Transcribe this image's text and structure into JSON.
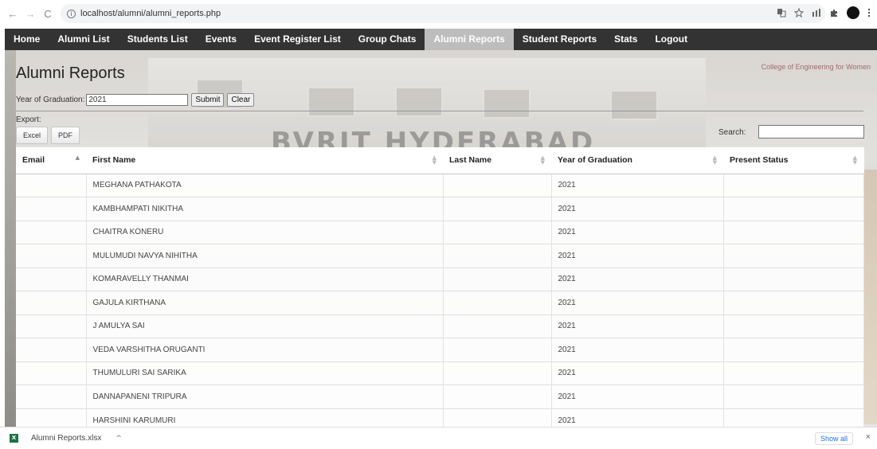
{
  "browser": {
    "url": "localhost/alumni/alumni_reports.php",
    "back_glyph": "←",
    "forward_glyph": "→",
    "reload_glyph": "C",
    "info_glyph": "i",
    "toolbar_icons": [
      "translate-icon",
      "star-icon",
      "media-icon",
      "extensions-icon",
      "profile-icon",
      "menu-icon"
    ]
  },
  "nav": {
    "items": [
      "Home",
      "Alumni List",
      "Students List",
      "Events",
      "Event Register List",
      "Group Chats",
      "Alumni Reports",
      "Student Reports",
      "Stats",
      "Logout"
    ],
    "active": "Alumni Reports"
  },
  "page": {
    "title": "Alumni Reports",
    "watermark": "BVRIT HYDERABAD",
    "sign_text": "College of Engineering for Women"
  },
  "filter": {
    "label": "Year of Graduation:",
    "value": "2021",
    "submit_label": "Submit",
    "clear_label": "Clear"
  },
  "export": {
    "label": "Export:",
    "excel_label": "Excel",
    "pdf_label": "PDF"
  },
  "search": {
    "label": "Search:",
    "value": ""
  },
  "table": {
    "columns": [
      "Email",
      "First Name",
      "Last Name",
      "Year of Graduation",
      "Present Status"
    ],
    "rows": [
      {
        "email": "",
        "first_name": "MEGHANA PATHAKOTA",
        "last_name": "",
        "year": "2021",
        "status": ""
      },
      {
        "email": "",
        "first_name": "KAMBHAMPATI NIKITHA",
        "last_name": "",
        "year": "2021",
        "status": ""
      },
      {
        "email": "",
        "first_name": "CHAITRA KONERU",
        "last_name": "",
        "year": "2021",
        "status": ""
      },
      {
        "email": "",
        "first_name": "MULUMUDI NAVYA NIHITHA",
        "last_name": "",
        "year": "2021",
        "status": ""
      },
      {
        "email": "",
        "first_name": "KOMARAVELLY THANMAI",
        "last_name": "",
        "year": "2021",
        "status": ""
      },
      {
        "email": "",
        "first_name": "GAJULA KIRTHANA",
        "last_name": "",
        "year": "2021",
        "status": ""
      },
      {
        "email": "",
        "first_name": "J AMULYA SAI",
        "last_name": "",
        "year": "2021",
        "status": ""
      },
      {
        "email": "",
        "first_name": "VEDA VARSHITHA ORUGANTI",
        "last_name": "",
        "year": "2021",
        "status": ""
      },
      {
        "email": "",
        "first_name": "THUMULURI SAI SARIKA",
        "last_name": "",
        "year": "2021",
        "status": ""
      },
      {
        "email": "",
        "first_name": "DANNAPANENI TRIPURA",
        "last_name": "",
        "year": "2021",
        "status": ""
      },
      {
        "email": "",
        "first_name": "HARSHINI KARUMURI",
        "last_name": "",
        "year": "2021",
        "status": ""
      }
    ]
  },
  "downloads": {
    "file_name": "Alumni Reports.xlsx",
    "chevron": "^",
    "show_all_label": "Show all",
    "close_glyph": "×"
  },
  "colors": {
    "nav_bg": "#333333",
    "nav_active_bg": "#bdbdbd",
    "link_blue": "#1a73e8"
  }
}
